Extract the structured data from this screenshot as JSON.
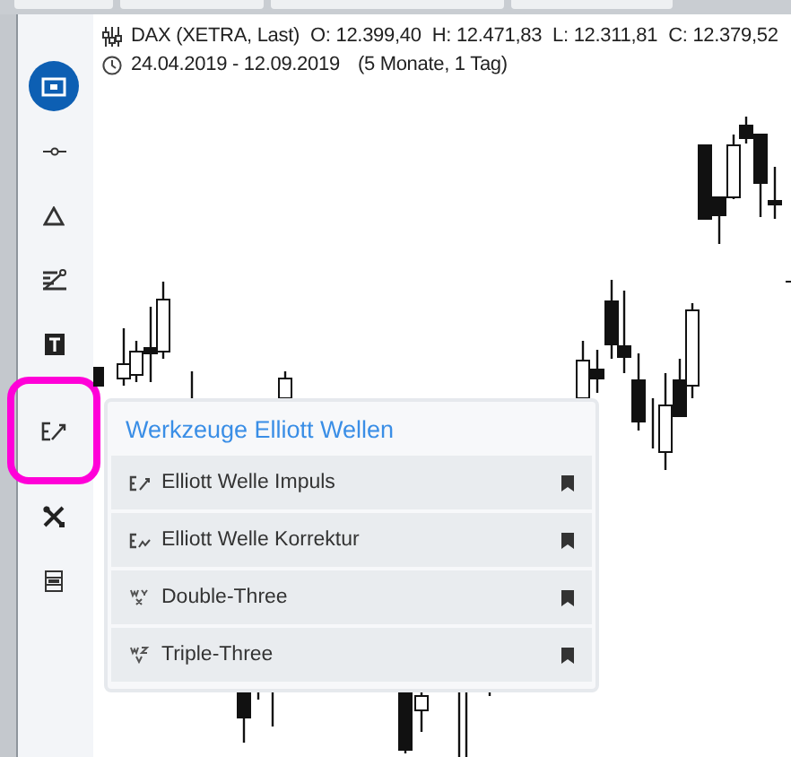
{
  "sidebar": {
    "items": [
      {
        "kind": "card",
        "selected": true,
        "highlighted": false
      },
      {
        "kind": "line",
        "selected": false,
        "highlighted": false
      },
      {
        "kind": "triangle",
        "selected": false,
        "highlighted": false
      },
      {
        "kind": "fib",
        "selected": false,
        "highlighted": false
      },
      {
        "kind": "text",
        "selected": false,
        "highlighted": false
      },
      {
        "kind": "elliott",
        "selected": false,
        "highlighted": true
      },
      {
        "kind": "tools",
        "selected": false,
        "highlighted": false
      },
      {
        "kind": "layout",
        "selected": false,
        "highlighted": false
      }
    ]
  },
  "header": {
    "instrument": "DAX (XETRA, Last)",
    "quotes": [
      "O: 12.399,40",
      "H: 12.471,83",
      "L: 12.311,81",
      "C: 12.379,52"
    ],
    "date_range": "24.04.2019 - 12.09.2019",
    "duration": "(5 Monate, 1 Tag)"
  },
  "menu": {
    "title": "Werkzeuge Elliott Wellen",
    "items": [
      {
        "kind": "impulse",
        "label": "Elliott Welle Impuls"
      },
      {
        "kind": "correction",
        "label": "Elliott Welle Korrektur"
      },
      {
        "kind": "double",
        "label": "Double-Three"
      },
      {
        "kind": "triple",
        "label": "Triple-Three"
      }
    ]
  }
}
